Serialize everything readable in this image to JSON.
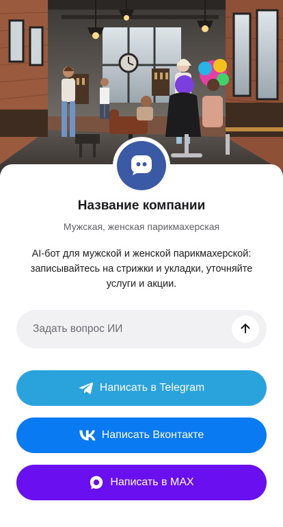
{
  "company": {
    "name": "Название компании",
    "type": "Мужская, женская парикмахерская",
    "description": "AI-бот для мужской и женской парикмахерской: записывайтесь на стрижки и укладки, уточняйте услуги и акции."
  },
  "hero": {
    "image": "barbershop-interior-illustration"
  },
  "avatar": {
    "icon": "chat-bubble-icon",
    "color": "#3b5aa6"
  },
  "ask": {
    "placeholder": "Задать вопрос ИИ",
    "value": "",
    "send_icon": "arrow-up-icon"
  },
  "actions": [
    {
      "label": "Написать в Telegram",
      "icon": "telegram-icon",
      "color": "#2aa3dd"
    },
    {
      "label": "Написать Вконтакте",
      "icon": "vk-icon",
      "color": "#0a7af2"
    },
    {
      "label": "Написать в MAX",
      "icon": "max-icon",
      "color": "#6a0ff0"
    }
  ]
}
